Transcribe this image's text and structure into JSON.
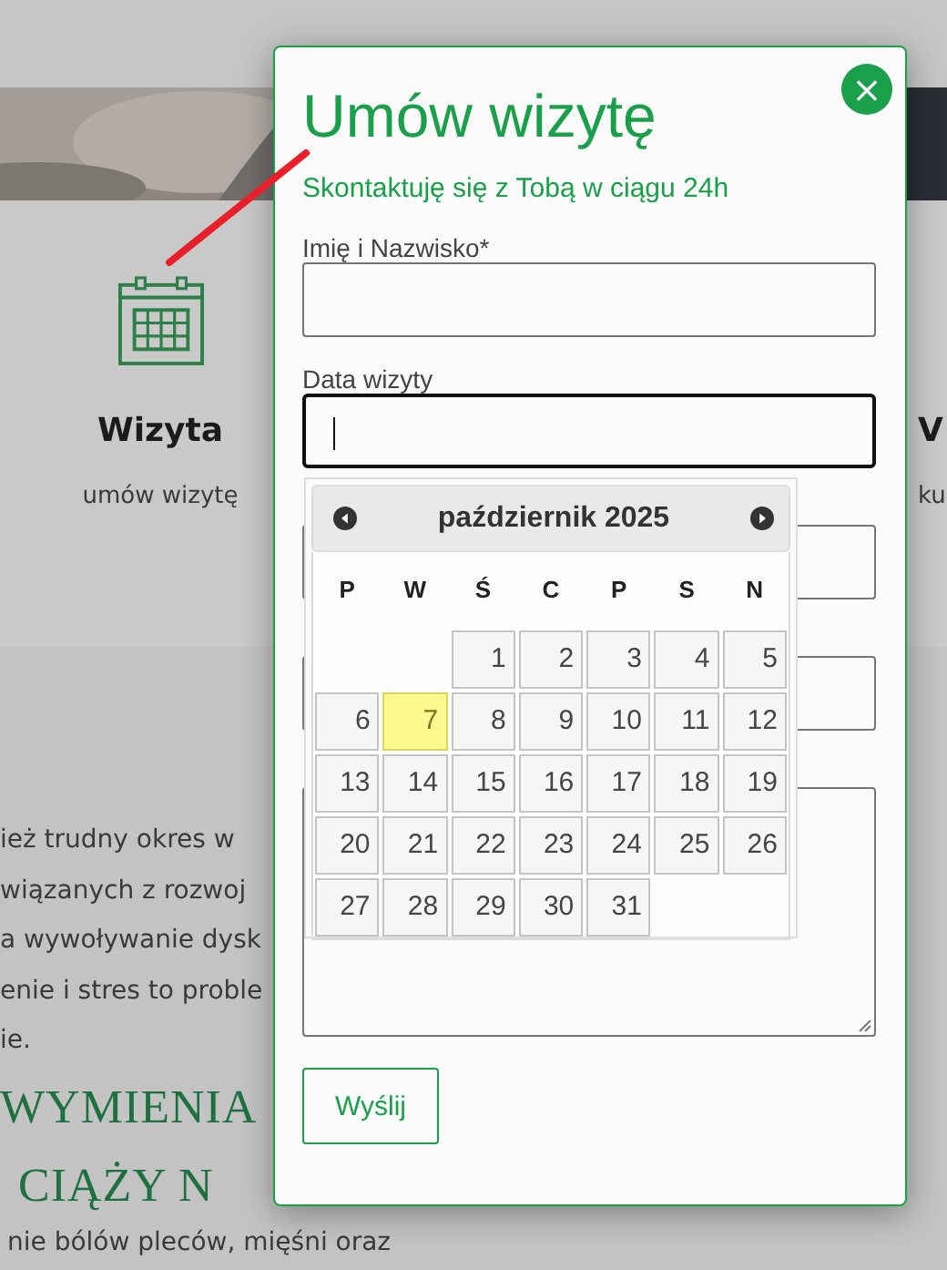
{
  "background": {
    "feature": {
      "title": "Wizyta",
      "subtitle": "umów wizytę"
    },
    "side_feature": {
      "title": "V",
      "subtitle": "ku"
    },
    "paragraph_lines": [
      "ież trudny okres w",
      "wiązanych z rozwoj",
      "a wywoływanie dysk",
      "enie i stres to proble",
      "ie."
    ],
    "heading_lines": [
      "WYMIENIA",
      "CIĄŻY N"
    ],
    "bottom_line": "nie bólów pleców, mięśni oraz"
  },
  "modal": {
    "title": "Umów wizytę",
    "subtitle": "Skontaktuję się z Tobą w ciągu 24h",
    "close": "×",
    "fields": [
      {
        "kind": "input",
        "label": "Imię i Nazwisko*",
        "focused": false
      },
      {
        "kind": "input",
        "label": "Data wizyty",
        "focused": true
      },
      {
        "kind": "input",
        "focused": false
      },
      {
        "kind": "input",
        "focused": false
      },
      {
        "kind": "textarea",
        "focused": false
      }
    ],
    "submit": "Wyślij"
  },
  "datepicker": {
    "month": "październik 2025",
    "weekdays": [
      "P",
      "W",
      "Ś",
      "C",
      "P",
      "S",
      "N"
    ],
    "weeks": [
      [
        {
          "kind": "blank"
        },
        {
          "kind": "blank"
        },
        {
          "kind": "day",
          "day": "1",
          "highlighted": false
        },
        {
          "kind": "day",
          "day": "2",
          "highlighted": false
        },
        {
          "kind": "day",
          "day": "3",
          "highlighted": false
        },
        {
          "kind": "day",
          "day": "4",
          "highlighted": false
        },
        {
          "kind": "day",
          "day": "5",
          "highlighted": false
        }
      ],
      [
        {
          "kind": "day",
          "day": "6",
          "highlighted": false
        },
        {
          "kind": "day",
          "day": "7",
          "highlighted": true
        },
        {
          "kind": "day",
          "day": "8",
          "highlighted": false
        },
        {
          "kind": "day",
          "day": "9",
          "highlighted": false
        },
        {
          "kind": "day",
          "day": "10",
          "highlighted": false
        },
        {
          "kind": "day",
          "day": "11",
          "highlighted": false
        },
        {
          "kind": "day",
          "day": "12",
          "highlighted": false
        }
      ],
      [
        {
          "kind": "day",
          "day": "13",
          "highlighted": false
        },
        {
          "kind": "day",
          "day": "14",
          "highlighted": false
        },
        {
          "kind": "day",
          "day": "15",
          "highlighted": false
        },
        {
          "kind": "day",
          "day": "16",
          "highlighted": false
        },
        {
          "kind": "day",
          "day": "17",
          "highlighted": false
        },
        {
          "kind": "day",
          "day": "18",
          "highlighted": false
        },
        {
          "kind": "day",
          "day": "19",
          "highlighted": false
        }
      ],
      [
        {
          "kind": "day",
          "day": "20",
          "highlighted": false
        },
        {
          "kind": "day",
          "day": "21",
          "highlighted": false
        },
        {
          "kind": "day",
          "day": "22",
          "highlighted": false
        },
        {
          "kind": "day",
          "day": "23",
          "highlighted": false
        },
        {
          "kind": "day",
          "day": "24",
          "highlighted": false
        },
        {
          "kind": "day",
          "day": "25",
          "highlighted": false
        },
        {
          "kind": "day",
          "day": "26",
          "highlighted": false
        }
      ],
      [
        {
          "kind": "day",
          "day": "27",
          "highlighted": false
        },
        {
          "kind": "day",
          "day": "28",
          "highlighted": false
        },
        {
          "kind": "day",
          "day": "29",
          "highlighted": false
        },
        {
          "kind": "day",
          "day": "30",
          "highlighted": false
        },
        {
          "kind": "day",
          "day": "31",
          "highlighted": false
        },
        {
          "kind": "blank"
        },
        {
          "kind": "blank"
        }
      ]
    ]
  }
}
